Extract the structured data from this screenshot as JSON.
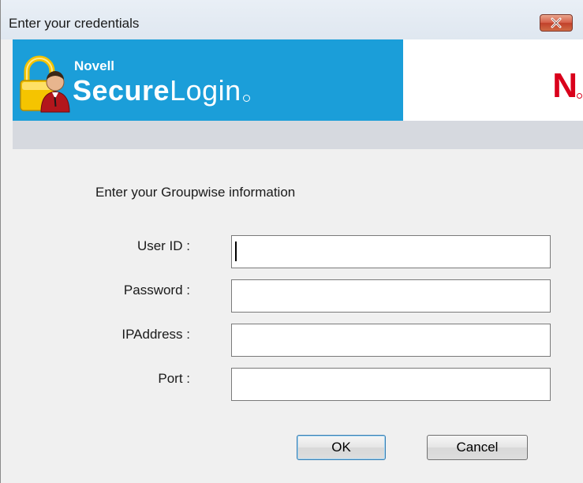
{
  "window": {
    "title": "Enter your credentials"
  },
  "banner": {
    "brand_small": "Novell",
    "brand_bold": "Secure",
    "brand_regular": "Login",
    "logo_letter": "N",
    "colors": {
      "banner_blue": "#1b9ed9",
      "novell_red": "#d9001b"
    },
    "icons": [
      "lock-user-icon",
      "novell-logo"
    ]
  },
  "form": {
    "heading": "Enter your Groupwise information",
    "fields": [
      {
        "label": "User ID :",
        "value": ""
      },
      {
        "label": "Password :",
        "value": ""
      },
      {
        "label": "IPAddress :",
        "value": ""
      },
      {
        "label": "Port :",
        "value": ""
      }
    ]
  },
  "buttons": {
    "ok": "OK",
    "cancel": "Cancel"
  }
}
